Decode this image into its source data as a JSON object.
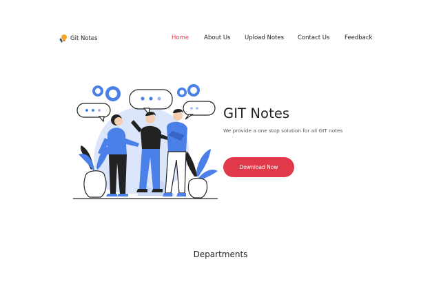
{
  "brand": {
    "name": "Git Notes",
    "icon": "lightbulb-icon"
  },
  "nav": {
    "items": [
      {
        "label": "Home",
        "active": true
      },
      {
        "label": "About Us",
        "active": false
      },
      {
        "label": "Upload Notes",
        "active": false
      },
      {
        "label": "Contact Us",
        "active": false
      },
      {
        "label": "Feedback",
        "active": false
      }
    ]
  },
  "hero": {
    "title": "GIT Notes",
    "subtitle": "We provide a one stop solution for all GIT notes",
    "cta_label": "Download Now",
    "illustration": "people-discussion-illustration"
  },
  "sections": {
    "departments_title": "Departments"
  },
  "colors": {
    "accent": "#e0394a",
    "illustration_blue": "#4a80e8",
    "illustration_light": "#dbe6fb",
    "text": "#222222"
  }
}
